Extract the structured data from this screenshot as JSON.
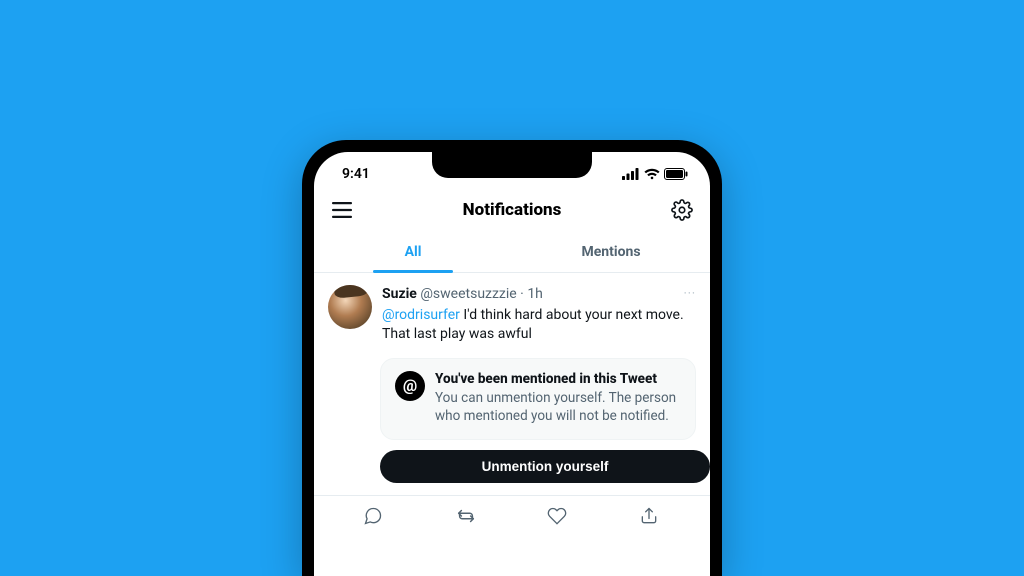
{
  "status": {
    "time": "9:41"
  },
  "header": {
    "title": "Notifications"
  },
  "tabs": {
    "all": "All",
    "mentions": "Mentions"
  },
  "tweet": {
    "name": "Suzie",
    "handle": "@sweetsuzzzie",
    "sep": " · ",
    "time": "1h",
    "mention": "@rodrisurfer",
    "body": " I'd think hard about your next move. That last play was awful",
    "more": "···"
  },
  "callout": {
    "at": "@",
    "title": "You've been mentioned in this Tweet",
    "desc": "You can unmention yourself. The person who mentioned you will not be notified.",
    "button": "Unmention yourself"
  }
}
